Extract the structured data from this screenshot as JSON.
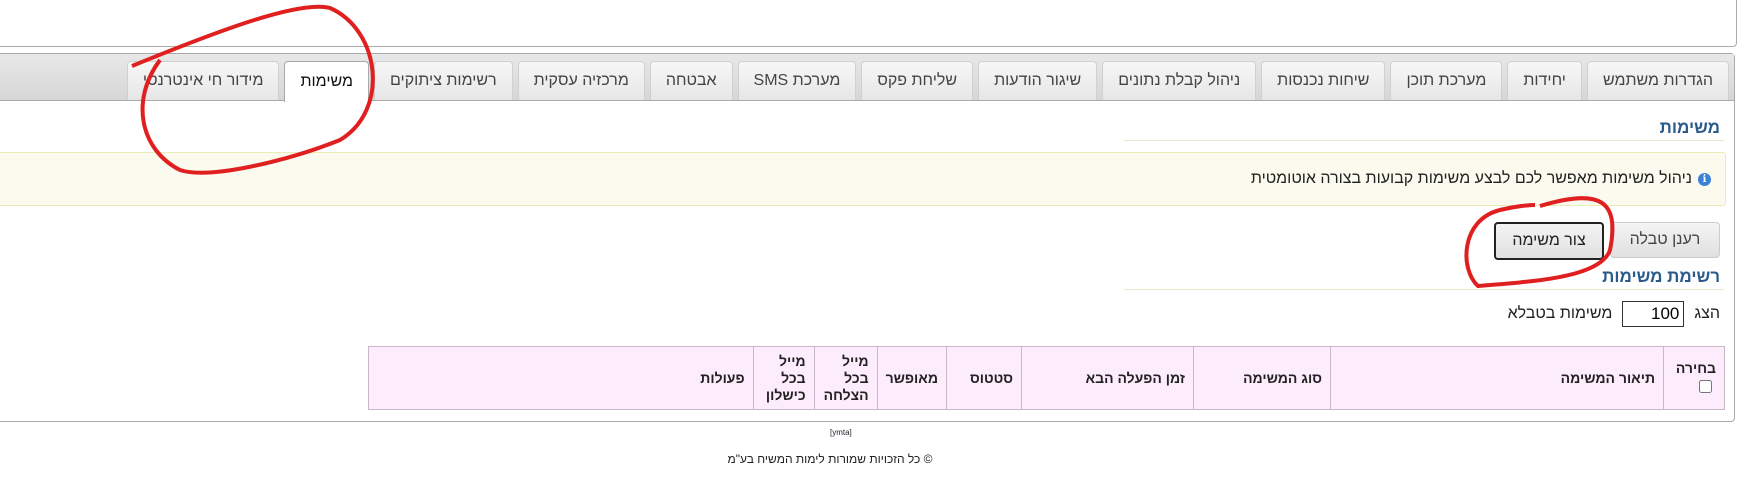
{
  "tabs": [
    {
      "label": "הגדרות משתמש",
      "active": false
    },
    {
      "label": "יחידות",
      "active": false
    },
    {
      "label": "מערכת תוכן",
      "active": false
    },
    {
      "label": "שיחות נכנסות",
      "active": false
    },
    {
      "label": "ניהול קבלת נתונים",
      "active": false
    },
    {
      "label": "שיגור הודעות",
      "active": false
    },
    {
      "label": "שליחת פקס",
      "active": false
    },
    {
      "label": "מערכת SMS",
      "active": false
    },
    {
      "label": "אבטחה",
      "active": false
    },
    {
      "label": "מרכזיה עסקית",
      "active": false
    },
    {
      "label": "רשימות ציתוקים",
      "active": false
    },
    {
      "label": "משימות",
      "active": true
    },
    {
      "label": "מידור חי אינטרנטי",
      "active": false
    }
  ],
  "section_title": "משימות",
  "info_text": "ניהול משימות מאפשר לכם לבצע משימות קבועות בצורה אוטומטית",
  "info_icon": "info-icon",
  "buttons": {
    "refresh": "רענן טבלה",
    "create": "צור משימה"
  },
  "list_title": "רשימת משימות",
  "show": {
    "prefix": "הצג",
    "value": "100",
    "suffix": "משימות בטבלא"
  },
  "table": {
    "select_header": "בחירה",
    "columns": [
      "תיאור המשימה",
      "סוג המשימה",
      "זמן הפעלה הבא",
      "סטטוס",
      "מאופשר",
      "מייל בכל הצלחה",
      "מייל בכל כישלון",
      "פעולות"
    ]
  },
  "footer": {
    "small": "[ymta]",
    "copyright": "© כל הזכויות שמורות לימות המשיח בע\"מ"
  },
  "colors": {
    "accent": "#2a5a8a",
    "table_header_bg": "#fcecfc",
    "info_bg": "#fbfaee",
    "annotation": "#e02020"
  }
}
